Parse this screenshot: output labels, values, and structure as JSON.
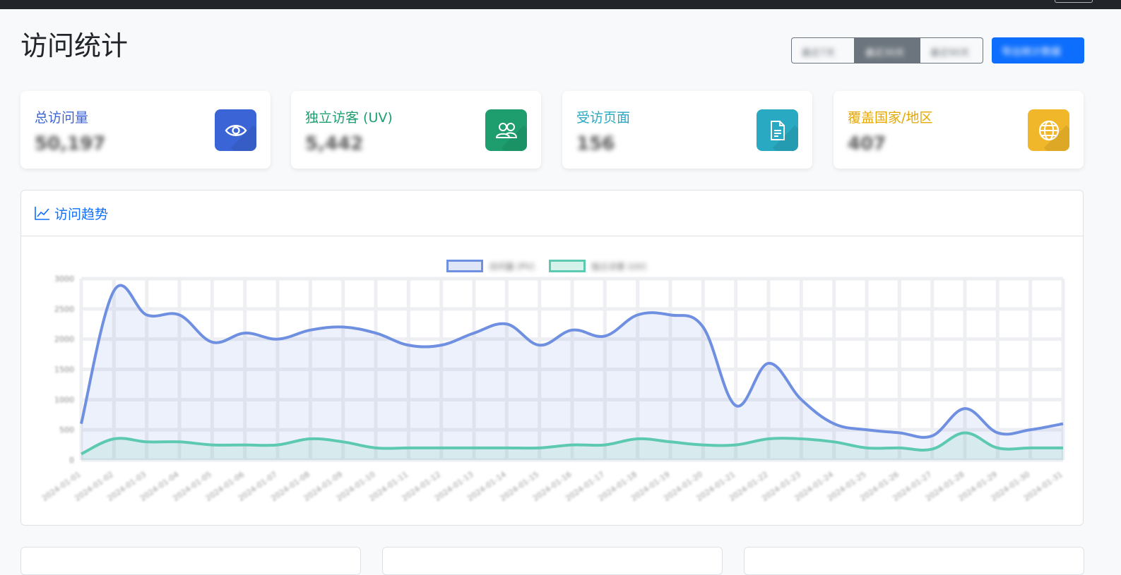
{
  "header": {
    "title": "访问统计",
    "range_buttons": [
      "最近7天",
      "最近30天",
      "最近90天"
    ],
    "selected_range_index": 1,
    "export_button": "导出统计数据"
  },
  "stats": [
    {
      "label": "总访问量",
      "value": "50,197",
      "color": "#3b64d6",
      "icon": "eye-icon"
    },
    {
      "label": "独立访客 (UV)",
      "value": "5,442",
      "color": "#1e9e6f",
      "icon": "users-icon"
    },
    {
      "label": "受访页面",
      "value": "156",
      "color": "#29a9c2",
      "icon": "document-icon"
    },
    {
      "label": "覆盖国家/地区",
      "value": "407",
      "color": "#e5a700",
      "icon": "globe-icon"
    }
  ],
  "trend": {
    "title": "访问趋势",
    "icon": "line-chart-icon"
  },
  "chart_data": {
    "type": "area",
    "ylim": [
      0,
      3000
    ],
    "y_ticks": [
      "0",
      "500",
      "1000",
      "1500",
      "2000",
      "2500",
      "3000"
    ],
    "x": [
      "2024-01-01",
      "2024-01-02",
      "2024-01-03",
      "2024-01-04",
      "2024-01-05",
      "2024-01-06",
      "2024-01-07",
      "2024-01-08",
      "2024-01-09",
      "2024-01-10",
      "2024-01-11",
      "2024-01-12",
      "2024-01-13",
      "2024-01-14",
      "2024-01-15",
      "2024-01-16",
      "2024-01-17",
      "2024-01-18",
      "2024-01-19",
      "2024-01-20",
      "2024-01-21",
      "2024-01-22",
      "2024-01-23",
      "2024-01-24",
      "2024-01-25",
      "2024-01-26",
      "2024-01-27",
      "2024-01-28",
      "2024-01-29",
      "2024-01-30",
      "2024-01-31"
    ],
    "series": [
      {
        "name": "访问量 (PV)",
        "color": "#6f8fe0",
        "values": [
          600,
          2800,
          2400,
          2400,
          1950,
          2100,
          2000,
          2150,
          2200,
          2100,
          1900,
          1900,
          2100,
          2250,
          1900,
          2150,
          2050,
          2400,
          2400,
          2200,
          900,
          1600,
          1000,
          600,
          500,
          450,
          400,
          850,
          450,
          500,
          600
        ]
      },
      {
        "name": "独立访客 (UV)",
        "color": "#5cc9b0",
        "values": [
          100,
          350,
          300,
          300,
          250,
          250,
          250,
          350,
          300,
          200,
          200,
          200,
          200,
          200,
          200,
          250,
          250,
          350,
          300,
          250,
          250,
          350,
          350,
          300,
          200,
          200,
          180,
          450,
          200,
          200,
          200
        ]
      }
    ],
    "grid": true,
    "legend": "top-center"
  }
}
